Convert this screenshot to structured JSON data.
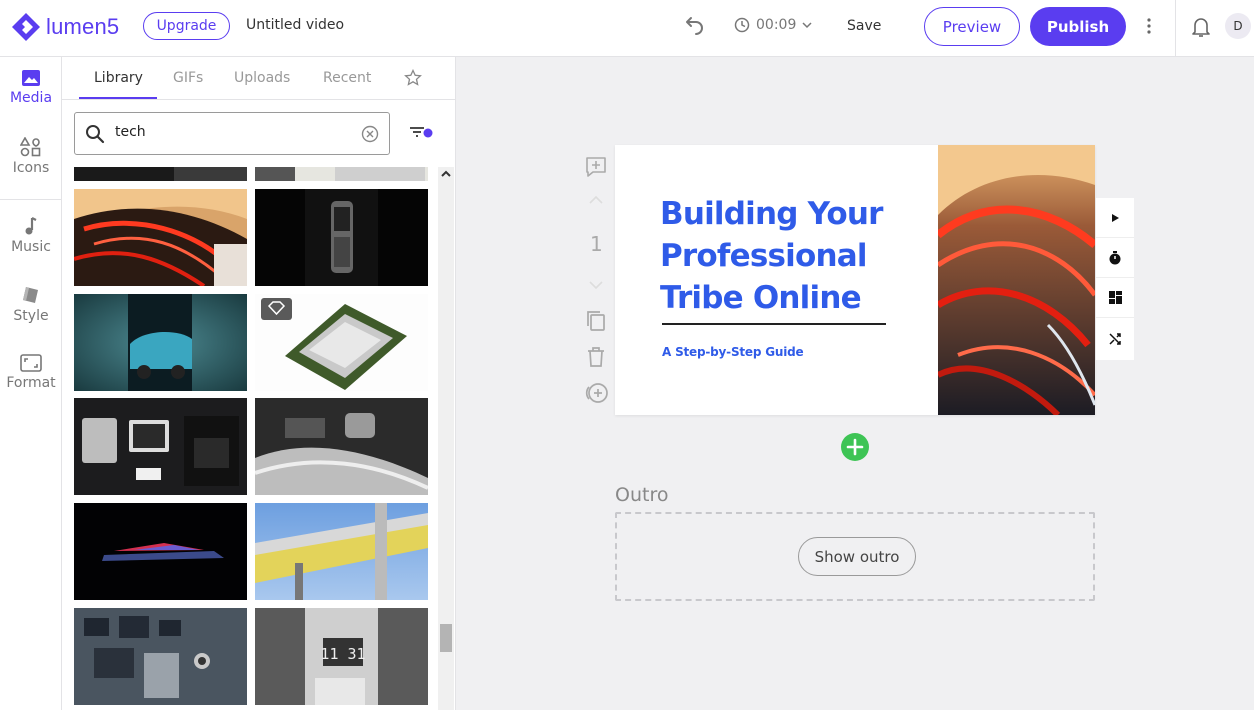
{
  "app": {
    "name": "lumen5",
    "upgrade_label": "Upgrade",
    "video_title": "Untitled video"
  },
  "header": {
    "duration": "00:09",
    "save_label": "Save",
    "preview_label": "Preview",
    "publish_label": "Publish",
    "avatar_initial": "D"
  },
  "rail": {
    "items": [
      {
        "label": "Media",
        "icon": "image-icon",
        "active": true
      },
      {
        "label": "Icons",
        "icon": "shapes-icon"
      },
      {
        "label": "Music",
        "icon": "music-note-icon"
      },
      {
        "label": "Style",
        "icon": "paint-icon"
      },
      {
        "label": "Format",
        "icon": "aspect-ratio-icon"
      }
    ]
  },
  "media": {
    "tabs": [
      {
        "label": "Library",
        "active": true
      },
      {
        "label": "GIFs"
      },
      {
        "label": "Uploads"
      },
      {
        "label": "Recent"
      }
    ],
    "search_value": "tech"
  },
  "scene": {
    "number": "1",
    "title_lines": [
      "Building Your",
      "Professional",
      "Tribe Online"
    ],
    "subtitle": "A Step-by-Step Guide"
  },
  "outro": {
    "label": "Outro",
    "button_label": "Show outro"
  },
  "colors": {
    "brand": "#5a3df0",
    "slide_text": "#2f5be8",
    "add_green": "#3ec455"
  }
}
